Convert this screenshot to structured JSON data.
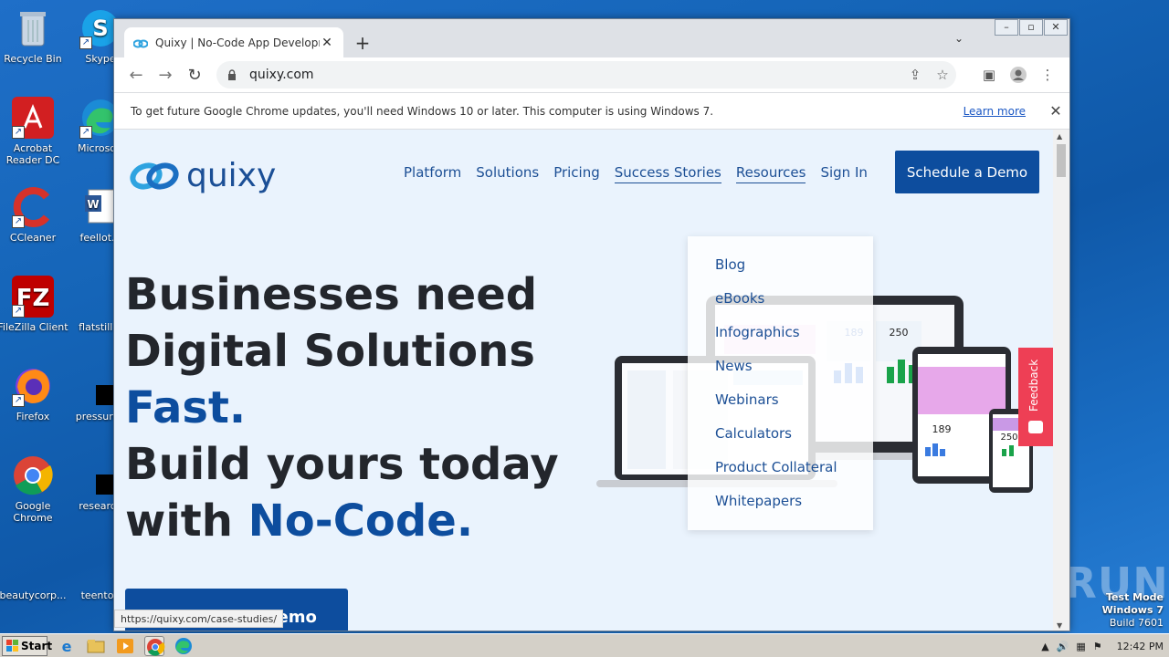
{
  "desktop": {
    "icons": [
      {
        "label": "Recycle Bin"
      },
      {
        "label": "Skype"
      },
      {
        "label": "Acrobat Reader DC"
      },
      {
        "label": "Microsoft"
      },
      {
        "label": "CCleaner"
      },
      {
        "label": "feellot..."
      },
      {
        "label": "FileZilla Client"
      },
      {
        "label": "flatstill.p"
      },
      {
        "label": "Firefox"
      },
      {
        "label": "pressureb"
      },
      {
        "label": "Google Chrome"
      },
      {
        "label": "research"
      },
      {
        "label": "beautycorp..."
      },
      {
        "label": "teentop"
      }
    ]
  },
  "browser": {
    "tab_title": "Quixy | No-Code App Development",
    "url": "quixy.com",
    "infobar": {
      "message": "To get future Google Chrome updates, you'll need Windows 10 or later. This computer is using Windows 7.",
      "learn_more": "Learn more"
    },
    "status_url": "https://quixy.com/case-studies/"
  },
  "page": {
    "logo_text": "quixy",
    "nav": [
      "Platform",
      "Solutions",
      "Pricing",
      "Success Stories",
      "Resources",
      "Sign In"
    ],
    "cta_top": "Schedule a Demo",
    "hero": {
      "line1": "Businesses need",
      "line2": "Digital Solutions",
      "line3": "Fast.",
      "line4": "Build yours today",
      "line5a": "with ",
      "line5b": "No-Code."
    },
    "cta_main": "Schedule a Demo",
    "resources_menu": [
      "Blog",
      "eBooks",
      "Infographics",
      "News",
      "Webinars",
      "Calculators",
      "Product Collateral",
      "Whitepapers"
    ],
    "feedback": "Feedback",
    "device_stats": [
      "189",
      "250",
      "189",
      "250"
    ]
  },
  "watermark": "ANY RUN",
  "test_mode": {
    "line1": "Test Mode",
    "line2": "Windows 7",
    "line3": "Build 7601"
  },
  "taskbar": {
    "start": "Start",
    "clock": "12:42 PM"
  }
}
